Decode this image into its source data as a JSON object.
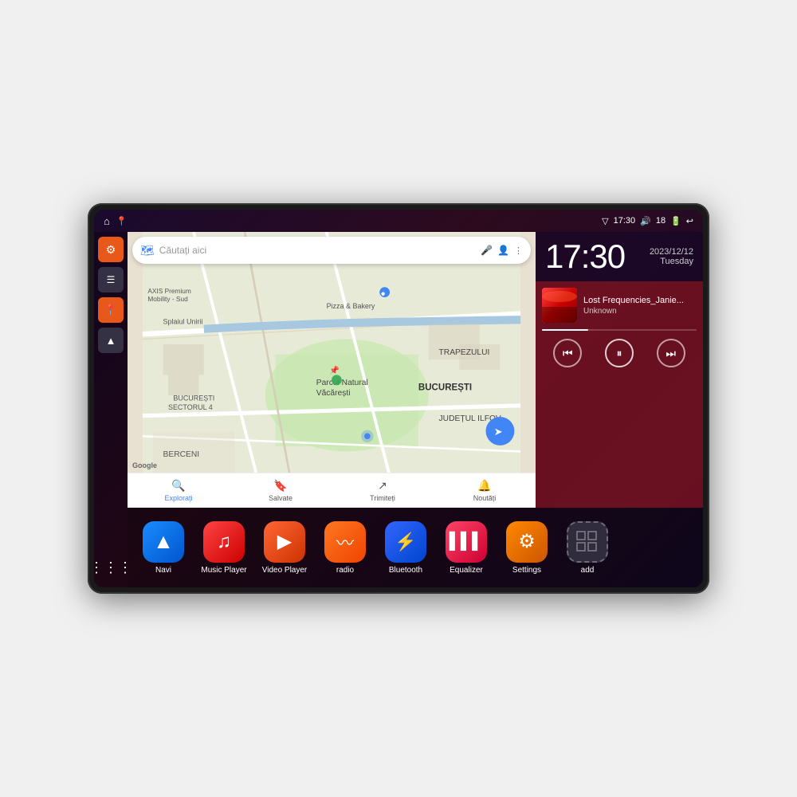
{
  "device": {
    "status_bar": {
      "left_icons": [
        "home",
        "location"
      ],
      "wifi_icon": "wifi",
      "time": "17:30",
      "volume_icon": "volume",
      "battery_level": "18",
      "battery_icon": "battery",
      "back_icon": "back"
    },
    "clock": {
      "time": "17:30",
      "date": "2023/12/12",
      "day": "Tuesday"
    },
    "music": {
      "title": "Lost Frequencies_Janie...",
      "artist": "Unknown",
      "album_art_emoji": "🎵"
    },
    "map": {
      "search_placeholder": "Căutați aici",
      "labels": [
        "AXIS Premium Mobility - Sud",
        "Pizza & Bakery",
        "Parcul Natural Văcărești",
        "BUCUREȘTI",
        "BUCUREȘTI SECTORUL 4",
        "BERCENI",
        "JUDEȚUL ILFOV",
        "TRAPEZULUI"
      ],
      "bottom_items": [
        "Explorați",
        "Salvate",
        "Trimiteți",
        "Noutăți"
      ]
    },
    "apps": [
      {
        "id": "navi",
        "label": "Navi",
        "icon_class": "app-navi",
        "icon": "🧭"
      },
      {
        "id": "music",
        "label": "Music Player",
        "icon_class": "app-music",
        "icon": "🎵"
      },
      {
        "id": "video",
        "label": "Video Player",
        "icon_class": "app-video",
        "icon": "▶"
      },
      {
        "id": "radio",
        "label": "radio",
        "icon_class": "app-radio",
        "icon": "📻"
      },
      {
        "id": "bluetooth",
        "label": "Bluetooth",
        "icon_class": "app-bt",
        "icon": "⚡"
      },
      {
        "id": "eq",
        "label": "Equalizer",
        "icon_class": "app-eq",
        "icon": "🎚"
      },
      {
        "id": "settings",
        "label": "Settings",
        "icon_class": "app-settings",
        "icon": "⚙"
      },
      {
        "id": "add",
        "label": "add",
        "icon_class": "app-add",
        "icon": "+"
      }
    ],
    "sidebar": [
      {
        "id": "settings",
        "icon": "⚙",
        "type": "orange"
      },
      {
        "id": "files",
        "icon": "▬",
        "type": "dark"
      },
      {
        "id": "location",
        "icon": "📍",
        "type": "orange"
      },
      {
        "id": "nav",
        "icon": "▲",
        "type": "dark"
      }
    ]
  }
}
